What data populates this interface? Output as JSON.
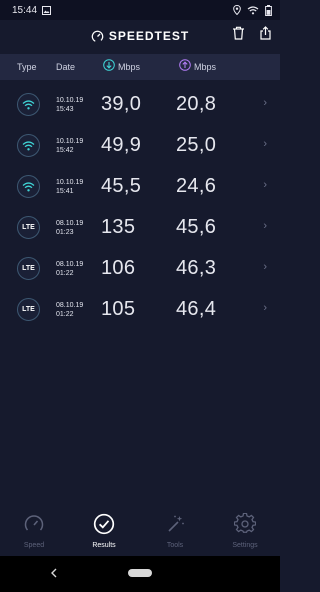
{
  "status_bar": {
    "time": "15:44"
  },
  "header": {
    "title": "SPEEDTEST"
  },
  "columns": {
    "type": "Type",
    "date": "Date",
    "download": "Mbps",
    "upload": "Mbps"
  },
  "results": [
    {
      "type": "wifi",
      "date": "10.10.19",
      "time": "15:43",
      "download": "39,0",
      "upload": "20,8"
    },
    {
      "type": "wifi",
      "date": "10.10.19",
      "time": "15:42",
      "download": "49,9",
      "upload": "25,0"
    },
    {
      "type": "wifi",
      "date": "10.10.19",
      "time": "15:41",
      "download": "45,5",
      "upload": "24,6"
    },
    {
      "type": "lte",
      "type_label": "LTE",
      "date": "08.10.19",
      "time": "01:23",
      "download": "135",
      "upload": "45,6"
    },
    {
      "type": "lte",
      "type_label": "LTE",
      "date": "08.10.19",
      "time": "01:22",
      "download": "106",
      "upload": "46,3"
    },
    {
      "type": "lte",
      "type_label": "LTE",
      "date": "08.10.19",
      "time": "01:22",
      "download": "105",
      "upload": "46,4"
    }
  ],
  "nav": [
    {
      "label": "Speed",
      "icon": "speedometer-icon"
    },
    {
      "label": "Results",
      "icon": "check-circle-icon",
      "active": true
    },
    {
      "label": "Tools",
      "icon": "magic-wand-icon"
    },
    {
      "label": "Settings",
      "icon": "gear-icon"
    }
  ],
  "colors": {
    "background": "#161A2D",
    "header_bar": "#232841",
    "download_accent": "#3FD4D6",
    "upload_accent": "#B07BF2",
    "wifi_accent": "#3FD4D6"
  }
}
